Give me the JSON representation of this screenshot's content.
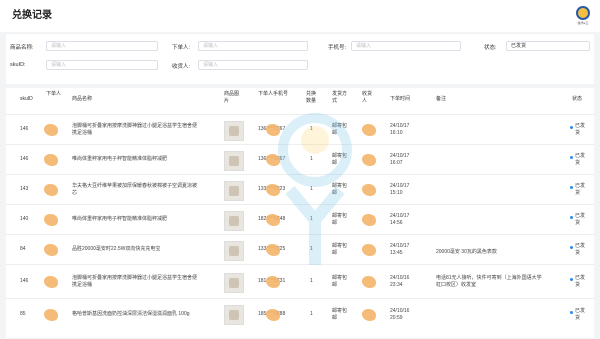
{
  "page": {
    "title": "兑换记录"
  },
  "logo": {
    "text": "快乐E卫"
  },
  "filters": {
    "product_name": {
      "label": "商品名称:",
      "placeholder": "请输入"
    },
    "user": {
      "label": "下单人:",
      "placeholder": "请输入"
    },
    "phone": {
      "label": "手机号:",
      "placeholder": "请输入"
    },
    "status": {
      "label": "状态:",
      "value": "已发货"
    },
    "sku": {
      "label": "skuID:",
      "placeholder": "请输入"
    },
    "receiver": {
      "label": "收货人:",
      "placeholder": "请输入"
    }
  },
  "table": {
    "headers": [
      "skuID",
      "下单人",
      "商品名称",
      "商品图片",
      "下单人手机号",
      "兑换数量",
      "发货方式",
      "收货人",
      "下单时间",
      "备注",
      "状态"
    ],
    "rows": [
      {
        "sku": "146",
        "name_l1": "泡脚桶可折叠家用按摩洗脚神器过小腿足浴盆学生宿舍便",
        "name_l2": "携足浴桶",
        "phone": "136****5367",
        "qty": "1",
        "ship_l1": "邮寄包",
        "ship_l2": "邮",
        "date": "24/10/17",
        "time": "16:10",
        "remark": "",
        "status_l1": "已发",
        "status_l2": "货"
      },
      {
        "sku": "146",
        "name_l1": "唯尚体重秤家用电子秤智能精准体脂秤减肥",
        "name_l2": "",
        "phone": "136****5367",
        "qty": "1",
        "ship_l1": "邮寄包",
        "ship_l2": "邮",
        "date": "24/10/17",
        "time": "16:07",
        "remark": "",
        "status_l1": "已发",
        "status_l2": "货"
      },
      {
        "sku": "143",
        "name_l1": "华夫格大豆纤维苹果被加厚保暖春秋被棉被子空调夏凉被",
        "name_l2": "芯",
        "phone": "133****2823",
        "qty": "1",
        "ship_l1": "邮寄包",
        "ship_l2": "邮",
        "date": "24/10/17",
        "time": "15:10",
        "remark": "",
        "status_l1": "已发",
        "status_l2": "货"
      },
      {
        "sku": "140",
        "name_l1": "唯尚体重秤家用电子秤智能精准体脂秤减肥",
        "name_l2": "",
        "phone": "182****0848",
        "qty": "1",
        "ship_l1": "邮寄包",
        "ship_l2": "邮",
        "date": "24/10/17",
        "time": "14:56",
        "remark": "",
        "status_l1": "已发",
        "status_l2": "货"
      },
      {
        "sku": "84",
        "name_l1": "品胜20000毫安时22.5W双向快充充电宝",
        "name_l2": "",
        "phone": "133****7325",
        "qty": "1",
        "ship_l1": "邮寄包",
        "ship_l2": "邮",
        "date": "24/10/17",
        "time": "13:45",
        "remark": "20000毫安 30瓦的黑色表款",
        "status_l1": "已发",
        "status_l2": "货"
      },
      {
        "sku": "146",
        "name_l1": "泡脚桶可折叠家用按摩洗脚神器过小腿足浴盆学生宿舍便",
        "name_l2": "携足浴桶",
        "phone": "181****5731",
        "qty": "1",
        "ship_l1": "邮寄包",
        "ship_l2": "邮",
        "date": "24/10/16",
        "time": "23:34",
        "remark_l1": "电话81无人接听，快件可寄到（上海外国语大学",
        "remark_l2": "虹口校区）收发室",
        "status_l1": "已发",
        "status_l2": "货"
      },
      {
        "sku": "85",
        "name_l1": "格哈普斯基因洗面奶控油深层清洁保湿滋润面乳 100g",
        "name_l2": "",
        "phone": "185****0888",
        "qty": "1",
        "ship_l1": "邮寄包",
        "ship_l2": "邮",
        "date": "24/10/16",
        "time": "20:59",
        "remark": "",
        "status_l1": "已发",
        "status_l2": "货"
      }
    ]
  },
  "colors": {
    "accent": "#2d8cf0",
    "watermark": "#7fc7e8",
    "blur": "#f4b56a"
  }
}
